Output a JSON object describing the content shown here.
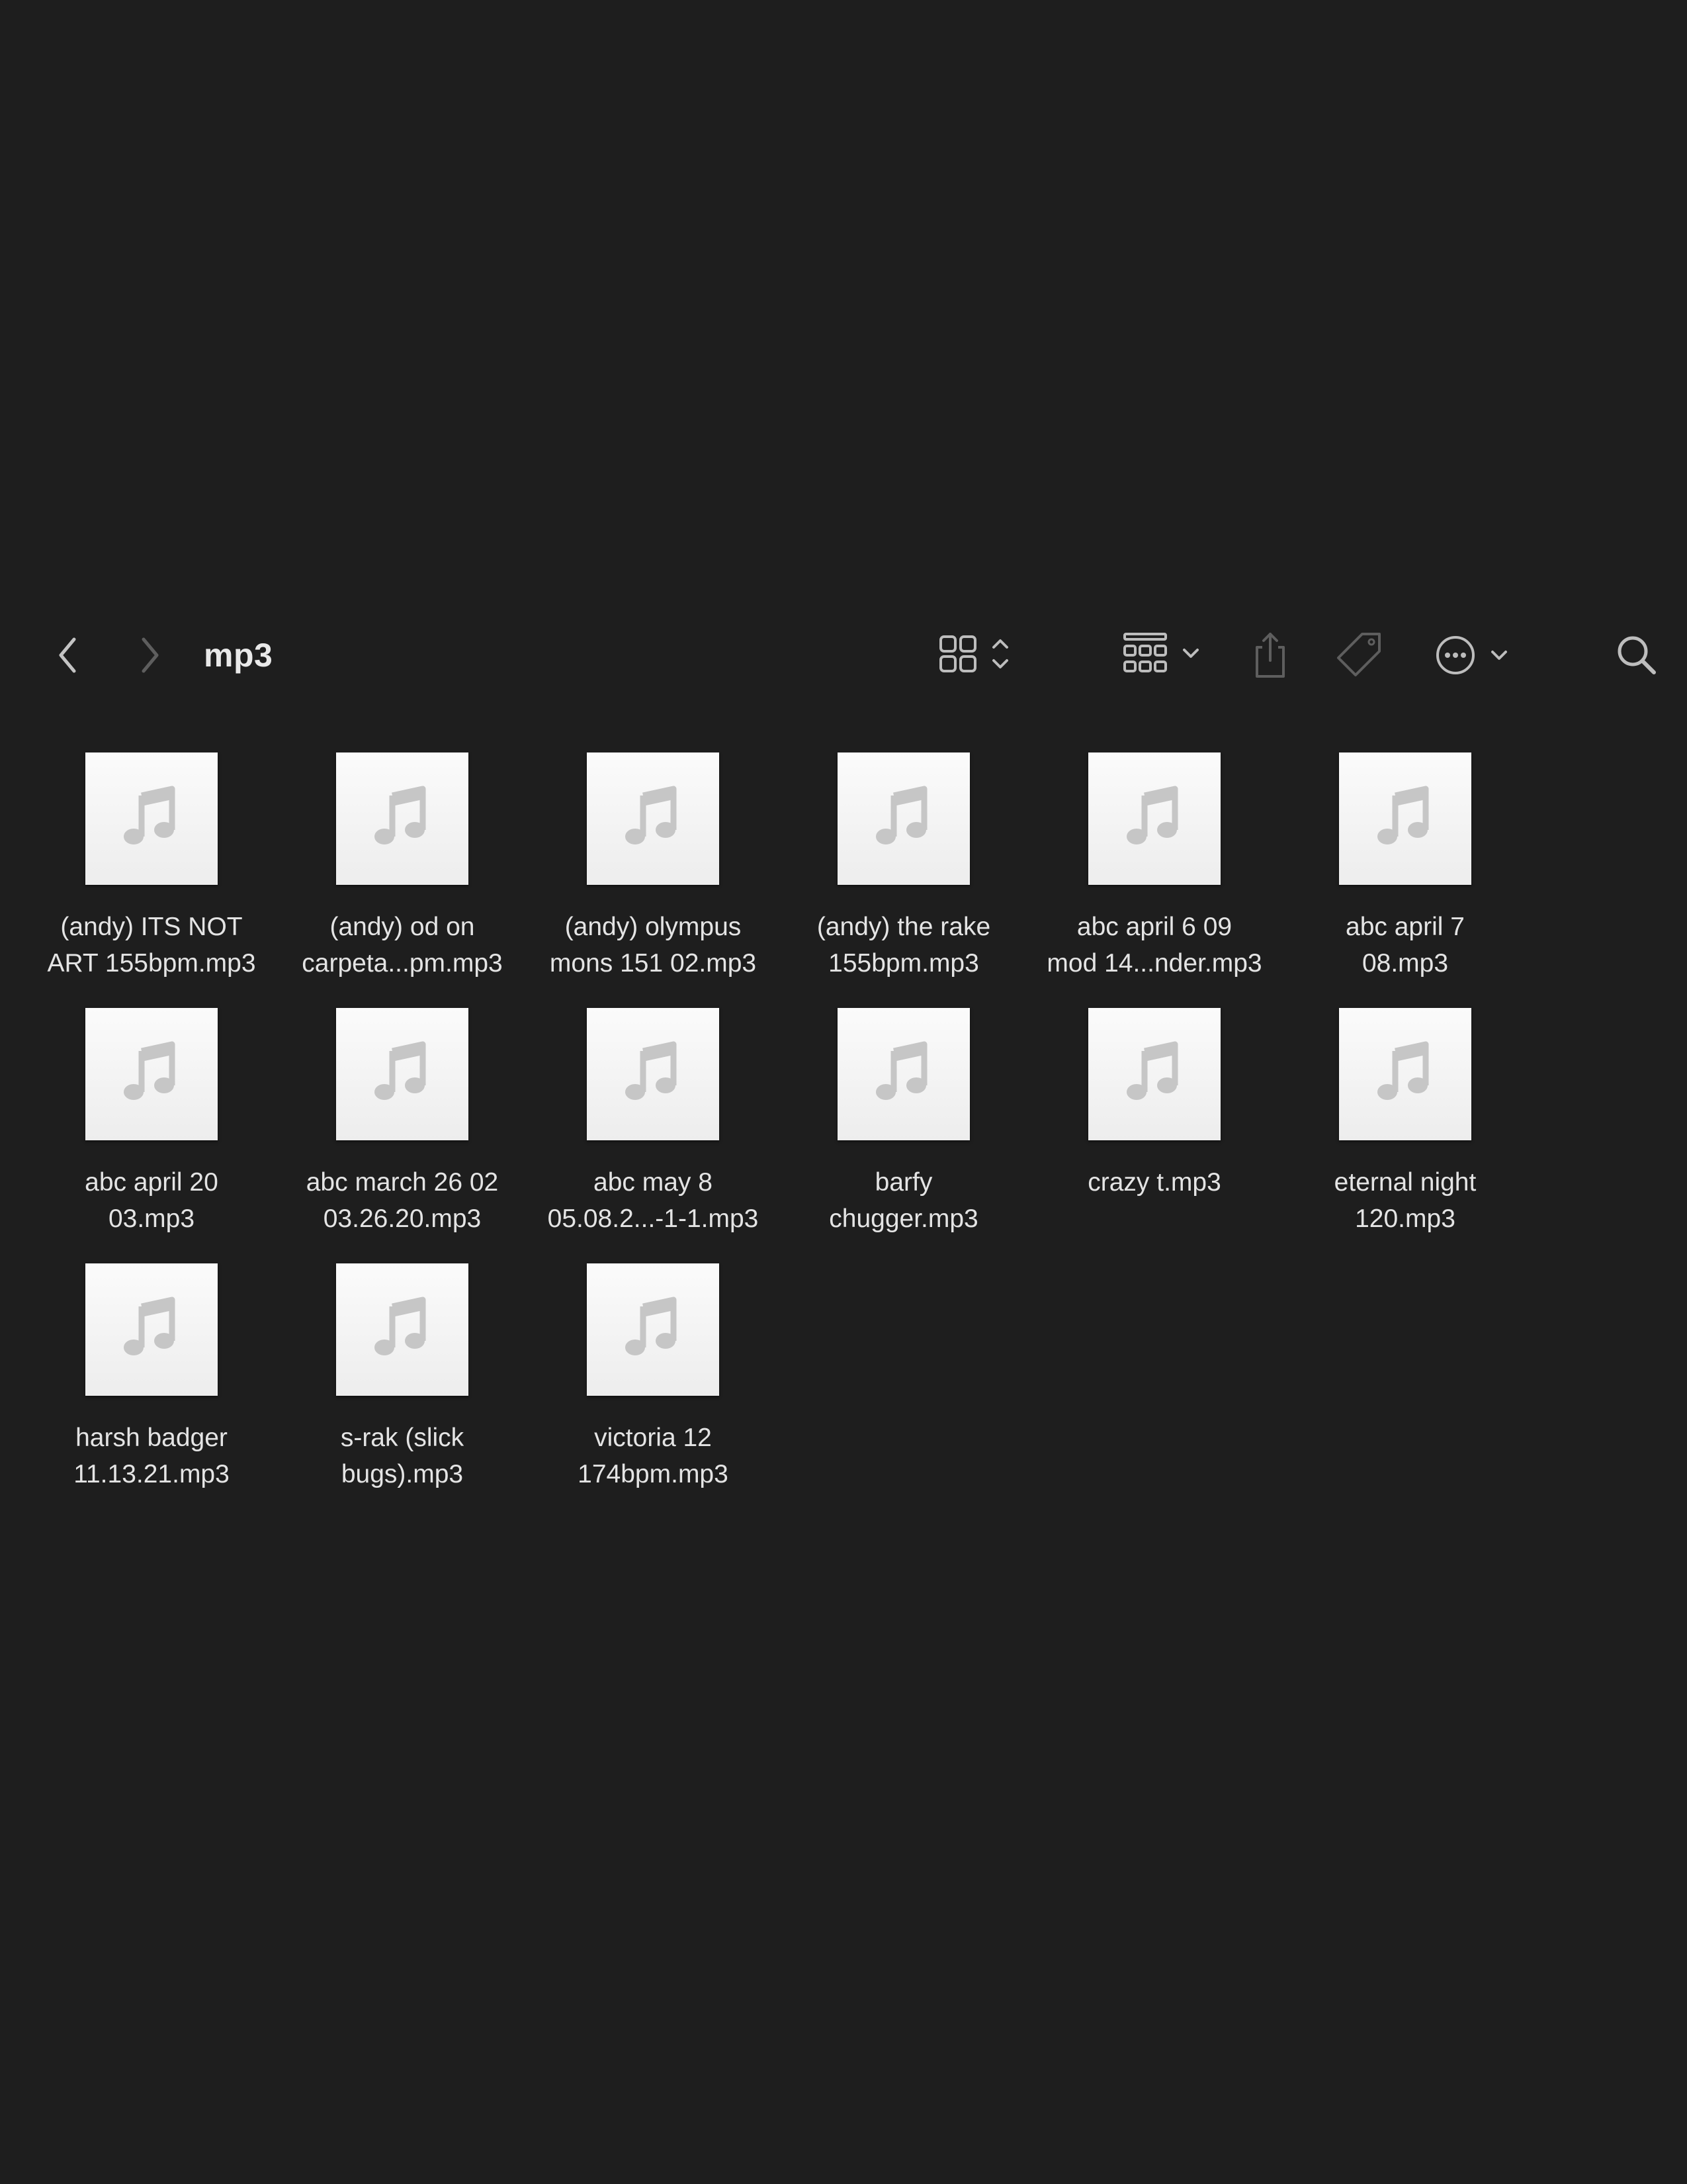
{
  "window": {
    "title": "mp3"
  },
  "toolbar": {
    "back_icon": "chevron-left-icon",
    "forward_icon": "chevron-right-icon",
    "view_mode_icon": "icon-grid-view-icon",
    "group_icon": "group-grid-icon",
    "share_icon": "share-icon",
    "tag_icon": "tag-icon",
    "more_icon": "ellipsis-circle-icon",
    "search_icon": "search-icon"
  },
  "colors": {
    "background": "#1e1e1e",
    "icon": "#bdbdbd",
    "icon_dim": "#5e5e5e",
    "text": "#e4e4e4"
  },
  "files": [
    {
      "line1": "(andy) ITS NOT",
      "line2": "ART 155bpm.mp3"
    },
    {
      "line1": "(andy) od on",
      "line2": "carpeta...pm.mp3"
    },
    {
      "line1": "(andy) olympus",
      "line2": "mons 151 02.mp3"
    },
    {
      "line1": "(andy) the rake",
      "line2": "155bpm.mp3"
    },
    {
      "line1": "abc april 6 09",
      "line2": "mod 14...nder.mp3"
    },
    {
      "line1": "abc april 7",
      "line2": "08.mp3"
    },
    {
      "line1": "abc april 20",
      "line2": "03.mp3"
    },
    {
      "line1": "abc march 26 02",
      "line2": "03.26.20.mp3"
    },
    {
      "line1": "abc may 8",
      "line2": "05.08.2...-1-1.mp3"
    },
    {
      "line1": "barfy",
      "line2": "chugger.mp3"
    },
    {
      "line1": "crazy t.mp3",
      "line2": ""
    },
    {
      "line1": "eternal night",
      "line2": "120.mp3"
    },
    {
      "line1": "harsh badger",
      "line2": "11.13.21.mp3"
    },
    {
      "line1": "s-rak (slick",
      "line2": "bugs).mp3"
    },
    {
      "line1": "victoria 12",
      "line2": "174bpm.mp3"
    }
  ]
}
